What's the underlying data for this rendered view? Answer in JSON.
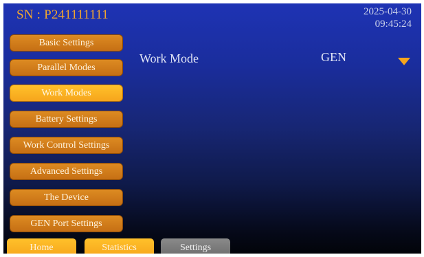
{
  "header": {
    "serial": "SN : P241111111",
    "date": "2025-04-30",
    "time": "09:45:24"
  },
  "sidebar": {
    "items": [
      {
        "label": "Basic Settings",
        "active": false
      },
      {
        "label": "Parallel Modes",
        "active": false
      },
      {
        "label": "Work Modes",
        "active": true
      },
      {
        "label": "Battery Settings",
        "active": false
      },
      {
        "label": "Work Control Settings",
        "active": false
      },
      {
        "label": "Advanced Settings",
        "active": false
      },
      {
        "label": "The Device",
        "active": false
      },
      {
        "label": "GEN Port Settings",
        "active": false
      }
    ]
  },
  "main": {
    "work_mode_label": "Work Mode",
    "work_mode_value": "GEN",
    "dropdown_icon": "triangle-down"
  },
  "tabs": {
    "home": "Home",
    "statistics": "Statistics",
    "settings": "Settings"
  },
  "colors": {
    "accent": "#f6a51c",
    "button": "#d27d1b",
    "serial_text": "#f2a62f",
    "background_top": "#1e33b4",
    "background_bottom": "#020409",
    "tab_inactive": "#7a7a7a"
  }
}
